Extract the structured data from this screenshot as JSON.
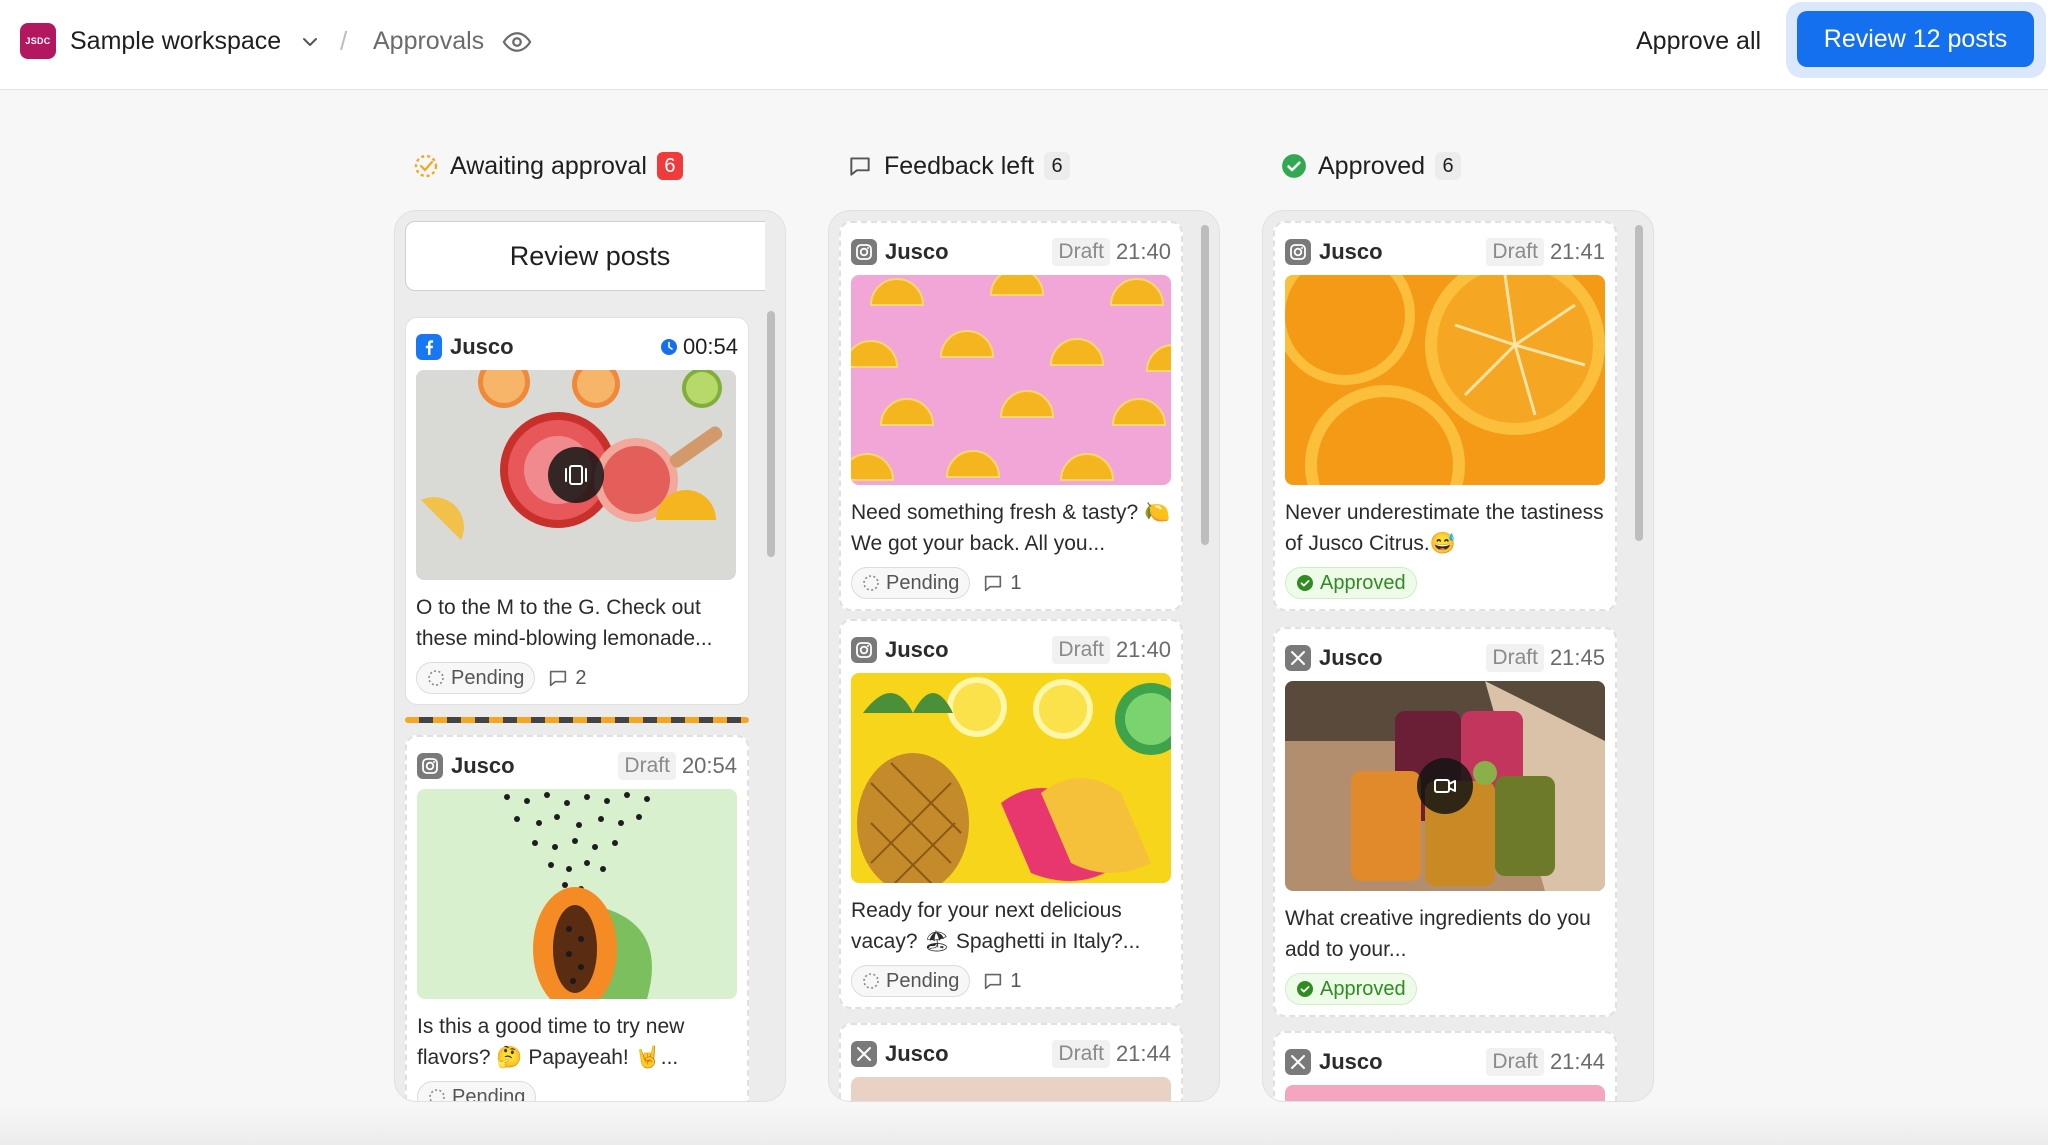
{
  "header": {
    "workspace_logo": "JSDC",
    "workspace_name": "Sample workspace",
    "separator": "/",
    "page": "Approvals",
    "approve_all": "Approve all",
    "review_button": "Review 12 posts"
  },
  "columns": [
    {
      "title": "Awaiting approval",
      "count": "6",
      "review_posts_label": "Review posts",
      "cards": [
        {
          "network": "facebook",
          "account": "Jusco",
          "time": "00:54",
          "caption": "O to the M to the G. Check out these mind-blowing lemonade...",
          "status": "Pending",
          "comments": "2"
        },
        {
          "network": "instagram",
          "account": "Jusco",
          "draft": "Draft",
          "time": "20:54",
          "caption": "Is this a good time to try new flavors? 🤔 Papayeah! 🤘...",
          "status": "Pending"
        }
      ]
    },
    {
      "title": "Feedback left",
      "count": "6",
      "cards": [
        {
          "network": "instagram",
          "account": "Jusco",
          "draft": "Draft",
          "time": "21:40",
          "caption": "Need something fresh & tasty? 🍋 We got your back. All you...",
          "status": "Pending",
          "comments": "1"
        },
        {
          "network": "instagram",
          "account": "Jusco",
          "draft": "Draft",
          "time": "21:40",
          "caption": "Ready for your next delicious vacay? 🏖 Spaghetti in Italy?...",
          "status": "Pending",
          "comments": "1"
        },
        {
          "network": "x",
          "account": "Jusco",
          "draft": "Draft",
          "time": "21:44"
        }
      ]
    },
    {
      "title": "Approved",
      "count": "6",
      "cards": [
        {
          "network": "instagram",
          "account": "Jusco",
          "draft": "Draft",
          "time": "21:41",
          "caption": "Never underestimate the tastiness of Jusco Citrus.😅",
          "status": "Approved"
        },
        {
          "network": "x",
          "account": "Jusco",
          "draft": "Draft",
          "time": "21:45",
          "caption": "What creative ingredients do you add to your...",
          "status": "Approved"
        },
        {
          "network": "x",
          "account": "Jusco",
          "draft": "Draft",
          "time": "21:44"
        }
      ]
    }
  ],
  "colors": {
    "primary": "#1570ef",
    "badge_red": "#ef3b3b",
    "approved_green": "#2f8b22",
    "logo": "#b3175f"
  }
}
